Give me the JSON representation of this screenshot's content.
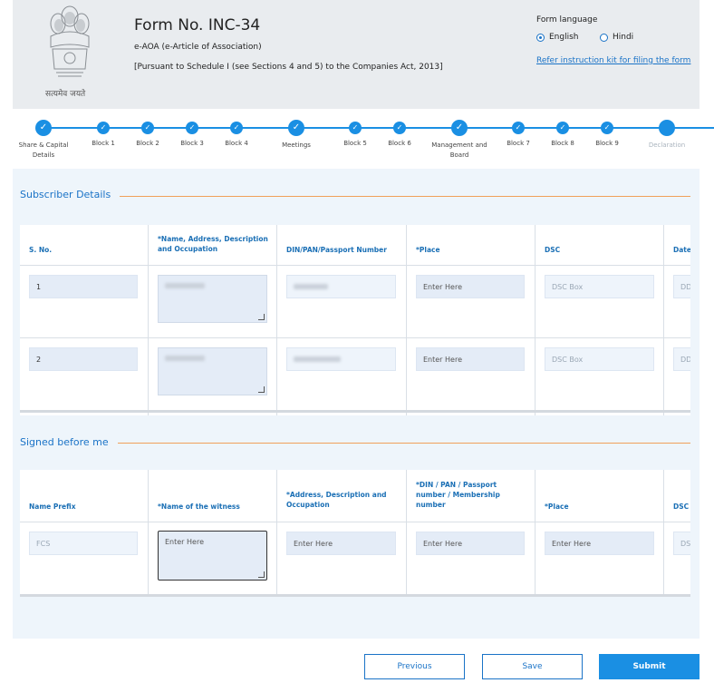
{
  "header": {
    "title": "Form No. INC-34",
    "subtitle": "e-AOA (e-Article of Association)",
    "pursuant": "[Pursuant to Schedule I (see Sections 4 and 5) to the Companies Act, 2013]",
    "emblem_motto": "सत्यमेव जयते",
    "language_label": "Form language",
    "languages": [
      {
        "label": "English",
        "selected": true
      },
      {
        "label": "Hindi",
        "selected": false
      }
    ],
    "refer_link": "Refer instruction kit for filing the form"
  },
  "stepper": {
    "steps": [
      {
        "label": "Share & Capital Details",
        "major": true,
        "done": true
      },
      {
        "label": "Block 1",
        "major": false,
        "done": true
      },
      {
        "label": "Block 2",
        "major": false,
        "done": true
      },
      {
        "label": "Block 3",
        "major": false,
        "done": true
      },
      {
        "label": "Block 4",
        "major": false,
        "done": true
      },
      {
        "label": "Meetings",
        "major": true,
        "done": true
      },
      {
        "label": "Block 5",
        "major": false,
        "done": true
      },
      {
        "label": "Block 6",
        "major": false,
        "done": true
      },
      {
        "label": "Management and Board",
        "major": true,
        "done": true
      },
      {
        "label": "Block 7",
        "major": false,
        "done": true
      },
      {
        "label": "Block 8",
        "major": false,
        "done": true
      },
      {
        "label": "Block 9",
        "major": false,
        "done": true
      },
      {
        "label": "Declaration",
        "major": true,
        "done": false,
        "current": true
      }
    ],
    "check_glyph": "✓"
  },
  "subscriber": {
    "title": "Subscriber Details",
    "headers": [
      "S. No.",
      "*Name, Address, Description and Occupation",
      "DIN/PAN/Passport Number",
      "*Place",
      "DSC",
      "Date"
    ],
    "rows": [
      {
        "sno": "1",
        "place_placeholder": "Enter Here",
        "dsc": "DSC Box",
        "date": "DD"
      },
      {
        "sno": "2",
        "place_placeholder": "Enter Here",
        "dsc": "DSC Box",
        "date": "DD"
      }
    ]
  },
  "witness": {
    "title": "Signed before me",
    "headers": [
      "Name Prefix",
      "*Name of the witness",
      "*Address, Description and Occupation",
      "*DIN / PAN / Passport number / Membership number",
      "*Place",
      "DSC"
    ],
    "row": {
      "prefix": "FCS",
      "name_placeholder": "Enter Here",
      "address_placeholder": "Enter Here",
      "din_placeholder": "Enter Here",
      "place_placeholder": "Enter Here",
      "dsc": "DS"
    }
  },
  "buttons": {
    "previous": "Previous",
    "save": "Save",
    "submit": "Submit"
  },
  "colors": {
    "accent": "#1a8fe3",
    "link": "#1a73c7",
    "section_line": "#f0a05a"
  }
}
